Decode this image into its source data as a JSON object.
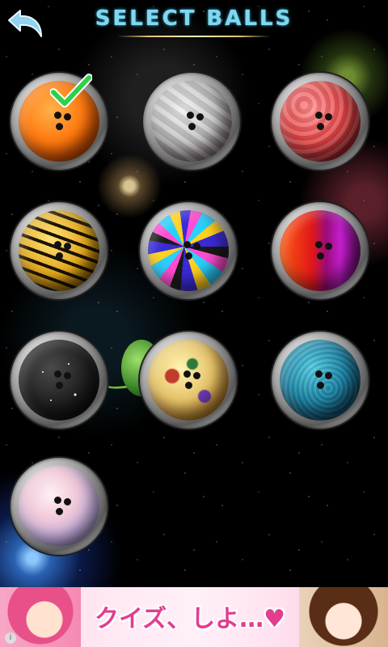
{
  "header": {
    "title": "SELECT BALLS",
    "back_icon": "back-arrow-icon"
  },
  "balls": [
    {
      "name": "orange",
      "selected": true
    },
    {
      "name": "silver",
      "selected": false
    },
    {
      "name": "red",
      "selected": false
    },
    {
      "name": "tiger",
      "selected": false
    },
    {
      "name": "swirl",
      "selected": false
    },
    {
      "name": "red-purple",
      "selected": false
    },
    {
      "name": "sparkle",
      "selected": false
    },
    {
      "name": "floral",
      "selected": false
    },
    {
      "name": "teal",
      "selected": false
    },
    {
      "name": "pastel",
      "selected": false
    }
  ],
  "selected_indicator_icon": "checkmark-icon",
  "ad": {
    "text": "クイズ、しよ…♥",
    "info_icon": "info-icon",
    "info_glyph": "i"
  },
  "colors": {
    "title": "#7fd8f0",
    "checkmark": "#2fcf4a",
    "ad_text": "#e23d8f"
  }
}
